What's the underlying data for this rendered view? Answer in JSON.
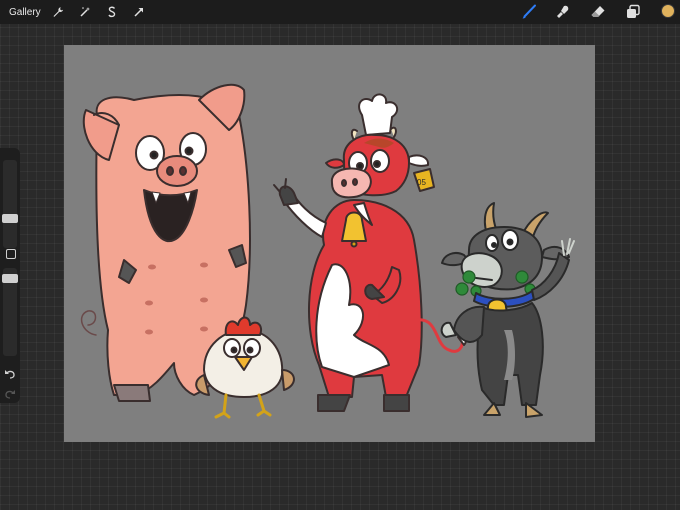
{
  "toolbar": {
    "gallery_label": "Gallery",
    "left_tools": [
      "wrench-icon",
      "magic-wand-icon",
      "selection-icon",
      "transform-arrow-icon"
    ],
    "right_tools": [
      "brush-icon",
      "smudge-icon",
      "eraser-icon",
      "layers-icon"
    ],
    "active_tool": "brush-icon",
    "accent_color": "#2e7cf6",
    "current_color": "#e0b25c"
  },
  "sidebar": {
    "brush_size_label": "brush-size-slider",
    "opacity_label": "opacity-slider",
    "modify_label": "modify-button",
    "undo_icon": "undo-icon",
    "redo_icon": "redo-icon"
  },
  "canvas": {
    "background": "#7f7f7f",
    "cow_tag": "05",
    "subjects": [
      "pig",
      "rooster",
      "cow",
      "goat"
    ]
  }
}
